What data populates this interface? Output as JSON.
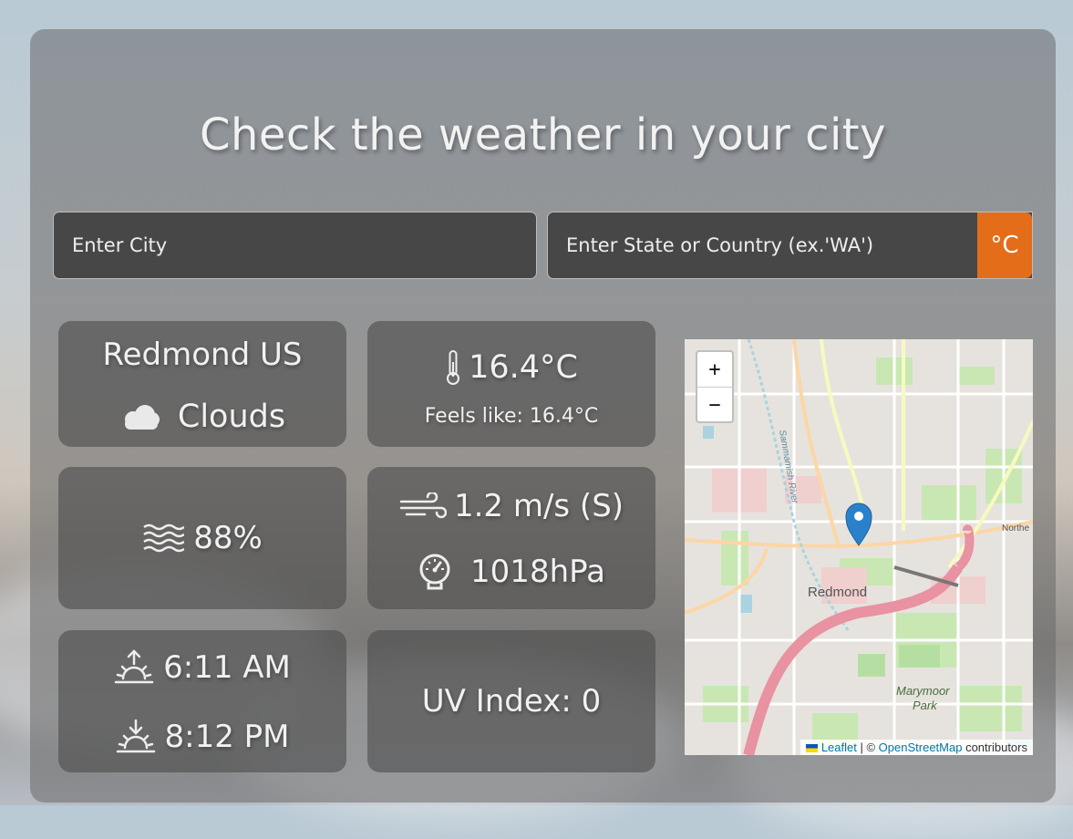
{
  "header": {
    "title": "Check the weather in your city"
  },
  "search": {
    "city_placeholder": "Enter City",
    "state_placeholder": "Enter State or Country (ex.'WA')",
    "unit_label": "°C"
  },
  "location": {
    "name": "Redmond US",
    "condition": "Clouds"
  },
  "temperature": {
    "value": "16.4°C",
    "feels_like": "Feels like: 16.4°C"
  },
  "humidity": {
    "value": "88%"
  },
  "wind": {
    "value": "1.2 m/s (S)"
  },
  "pressure": {
    "value": "1018hPa"
  },
  "sun": {
    "sunrise": "6:11 AM",
    "sunset": "8:12 PM"
  },
  "uv": {
    "text": "UV Index: 0"
  },
  "map": {
    "zoom_in": "+",
    "zoom_out": "−",
    "labels": {
      "river": "Sammamish River",
      "city": "Redmond",
      "park_line1": "Marymoor",
      "park_line2": "Park",
      "road": "Northe"
    },
    "attribution": {
      "leaflet": "Leaflet",
      "separator": " | © ",
      "osm": "OpenStreetMap",
      "contributors": " contributors"
    }
  },
  "colors": {
    "accent": "#e46d1a",
    "marker": "#2a81cb"
  }
}
